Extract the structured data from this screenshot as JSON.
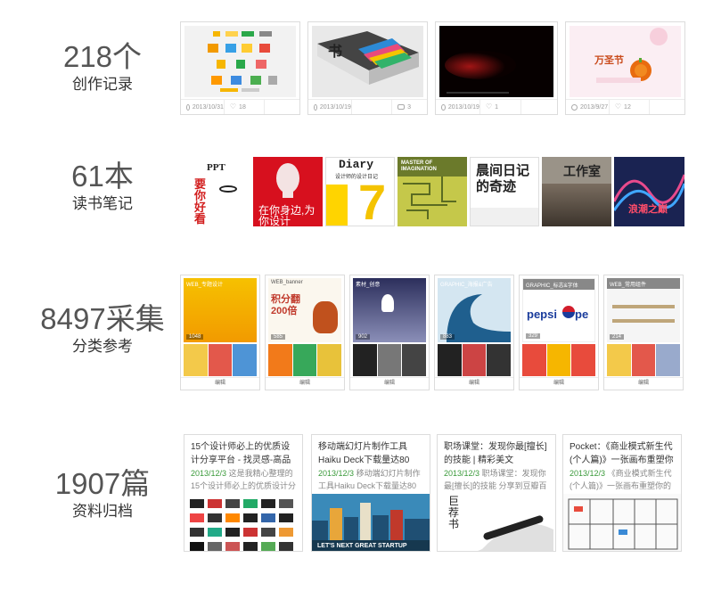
{
  "sections": [
    {
      "id": "works",
      "count": "218个",
      "label": "创作记录",
      "cards": [
        {
          "date": "2013/10/31",
          "likes": "18",
          "icon": "heart-icon"
        },
        {
          "date": "2013/10/19",
          "comments": "3",
          "icon": "comment-icon"
        },
        {
          "date": "2013/10/19",
          "likes": "1",
          "icon": "heart-icon"
        },
        {
          "date": "2013/9/27",
          "likes": "12",
          "icon": "heart-icon",
          "thumb_text": "万圣节"
        }
      ]
    },
    {
      "id": "books",
      "count": "61本",
      "label": "读书笔记",
      "covers": [
        {
          "text": "PPT",
          "sub": "要你好看"
        },
        {
          "text": "在你身边,为你设计"
        },
        {
          "text": "Diary",
          "sub": "设计师的设计日记"
        },
        {
          "text": "MASTER OF IMAGINATION"
        },
        {
          "text": "晨间日记的奇迹"
        },
        {
          "text": "工作室"
        },
        {
          "text": "浪潮之巅"
        }
      ]
    },
    {
      "id": "collections",
      "count": "8497采集",
      "label": "分类参考",
      "boards": [
        {
          "tag": "WEB_专题设计",
          "count": "1048",
          "edit": "编辑"
        },
        {
          "tag": "WEB_banner",
          "count": "585",
          "edit": "编辑",
          "promo": "积分翻200倍"
        },
        {
          "tag": "素材_创意",
          "count": "902",
          "edit": "编辑"
        },
        {
          "tag": "GRAPHIC_海报&广告",
          "count": "883",
          "edit": "编辑"
        },
        {
          "tag": "GRAPHIC_标志&字体",
          "count": "329",
          "edit": "编辑",
          "brand1": "pepsi",
          "brand2": "pe"
        },
        {
          "tag": "WEB_常用组件",
          "count": "214",
          "edit": "编辑"
        }
      ]
    },
    {
      "id": "documents",
      "count": "1907篇",
      "label": "资料归档",
      "docs": [
        {
          "title": "15个设计师必上的优质设计分享平台 - 找灵感-高品质的",
          "date": "2013/12/3",
          "desc": "这是我精心整理的15个设计师必上的优质设计分享平台"
        },
        {
          "title": "移动端幻灯片制作工具Haiku Deck下载量达80万，新推出",
          "date": "2013/12/3",
          "desc": "移动端幻灯片制作工具Haiku Deck下载量达80万，新",
          "img_text": "LET'S NEXT GREAT STARTUP"
        },
        {
          "title": "职场课堂：发现你最[擅长]的技能 | 精彩美文",
          "date": "2013/12/3",
          "desc": "职场课堂：发现你最[擅长]的技能 分享到豆瓣百度收藏",
          "img_text": "巨荐书"
        },
        {
          "title": "Pocket：《商业模式新生代(个人篇)》一张画布重塑你的职",
          "date": "2013/12/3",
          "desc": "《商业模式新生代(个人篇)》一张画布重塑你的职业生"
        }
      ]
    }
  ],
  "colors": {
    "date_green": "#3a9a3a",
    "stat_gray": "#555555"
  }
}
